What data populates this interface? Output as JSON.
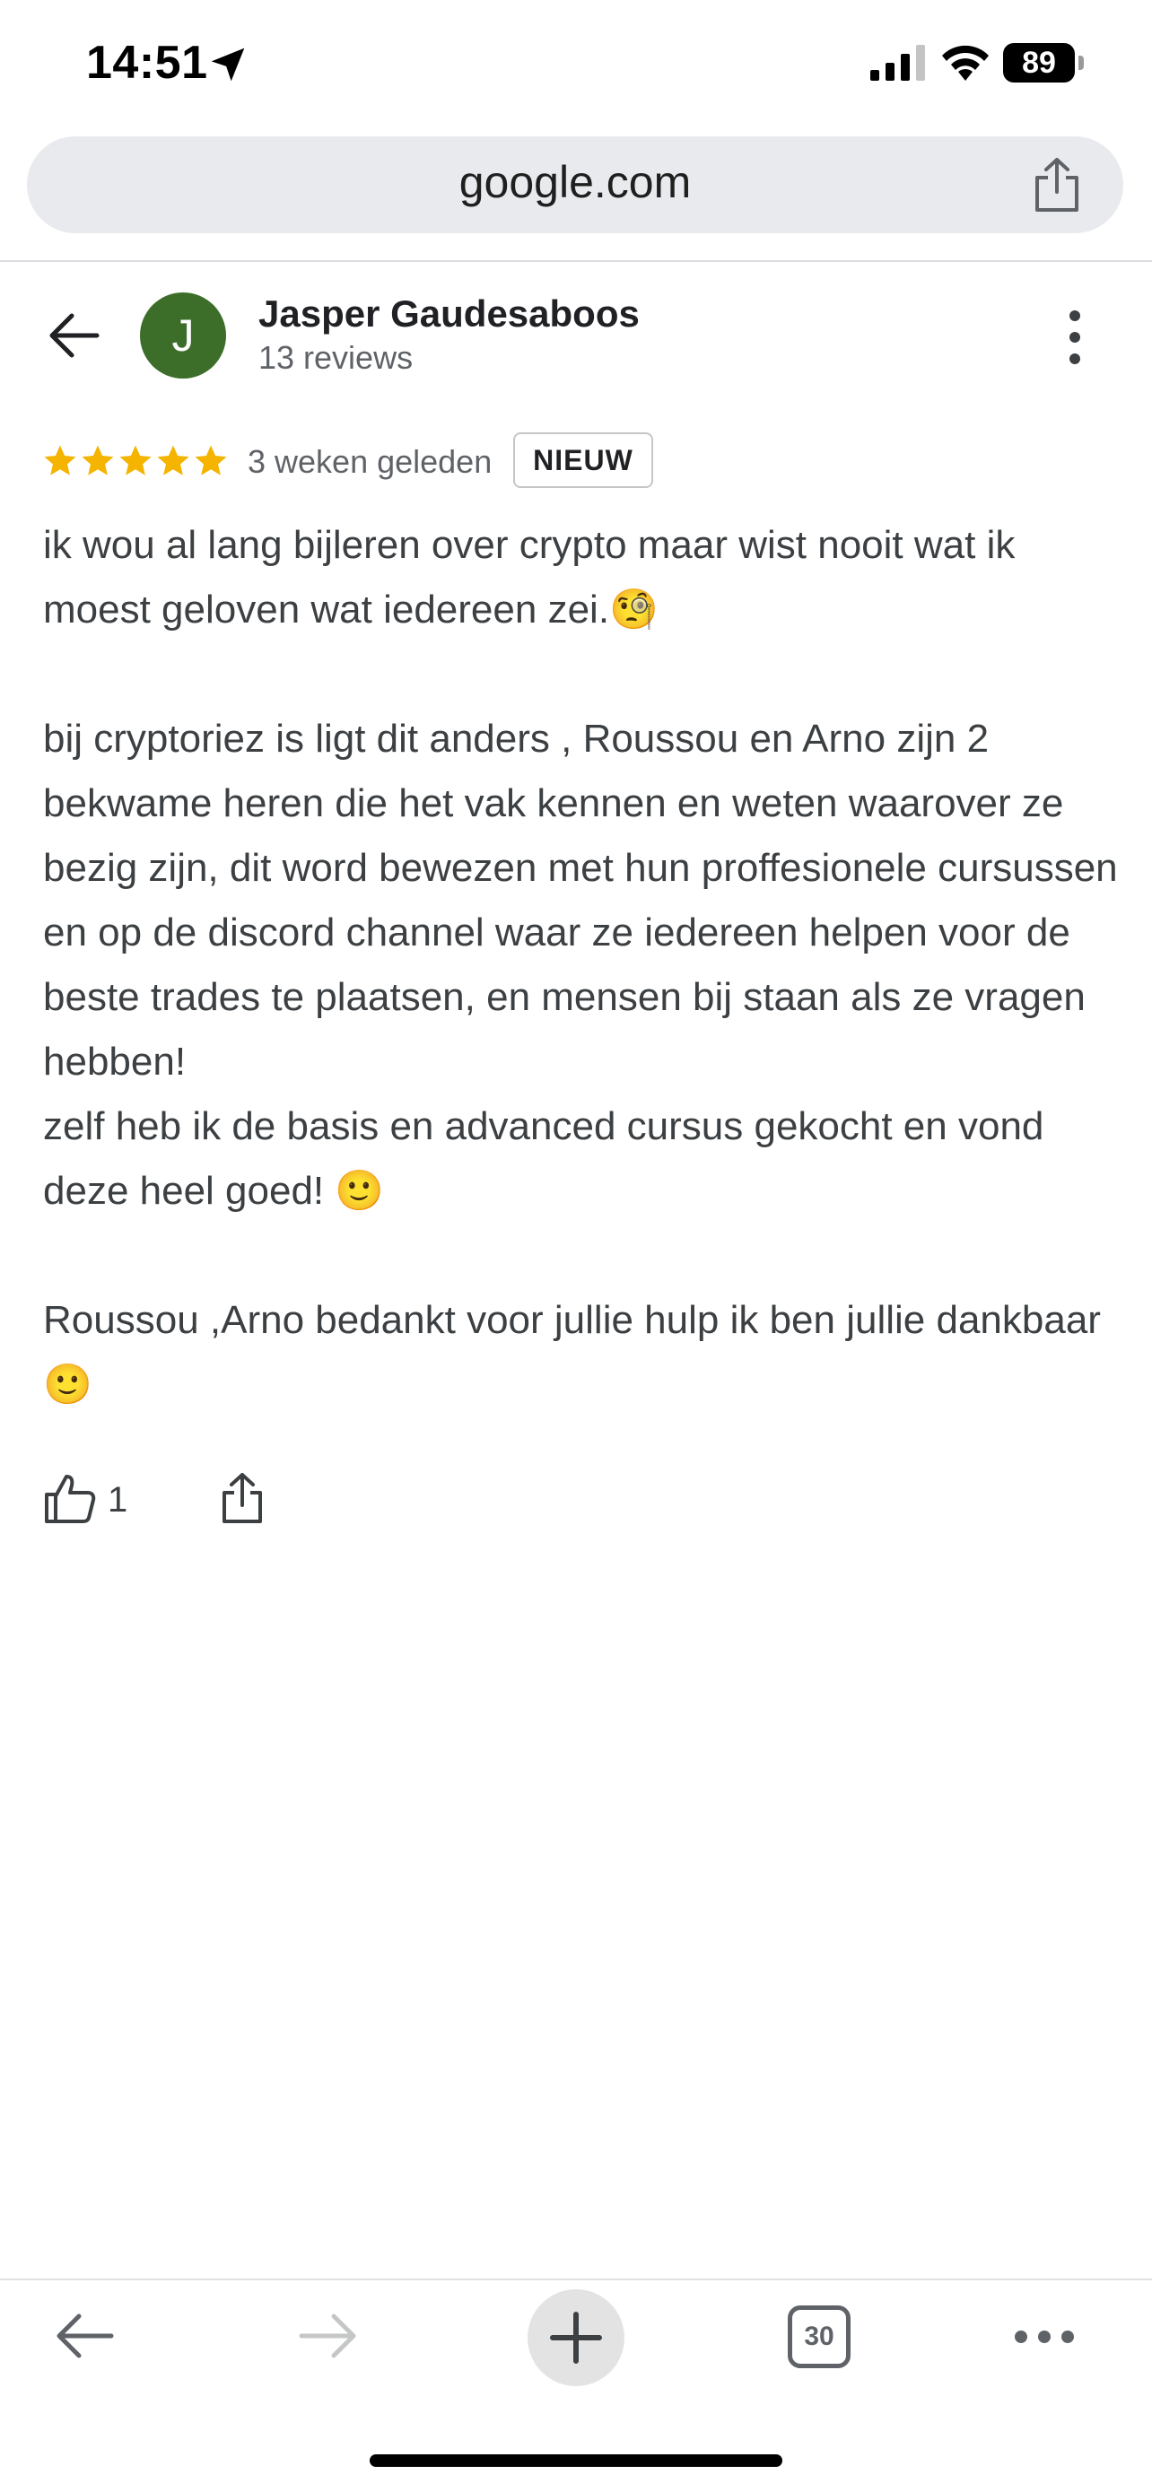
{
  "status_bar": {
    "time": "14:51",
    "battery": "89"
  },
  "browser": {
    "url": "google.com",
    "tab_count": "30"
  },
  "review": {
    "reviewer_name": "Jasper Gaudesaboos",
    "reviewer_stats": "13 reviews",
    "avatar_initial": "J",
    "rating": 5,
    "time_ago": "3 weken geleden",
    "badge": "NIEUW",
    "paragraphs": [
      "ik wou al lang bijleren over crypto maar wist nooit wat ik moest geloven wat iedereen zei.🧐",
      "bij cryptoriez is ligt dit anders , Roussou en Arno zijn 2 bekwame heren die het vak kennen en weten waarover ze bezig zijn, dit word bewezen met hun proffesionele cursussen en op de discord channel waar ze iedereen helpen voor de beste trades te plaatsen, en mensen bij staan als ze vragen hebben!\nzelf heb ik de basis en advanced cursus gekocht en vond deze heel goed! 🙂",
      "Roussou ,Arno bedankt voor jullie hulp ik ben jullie dankbaar🙂"
    ],
    "like_count": "1"
  },
  "colors": {
    "star": "#f4b400",
    "avatar": "#3c6e2a"
  }
}
